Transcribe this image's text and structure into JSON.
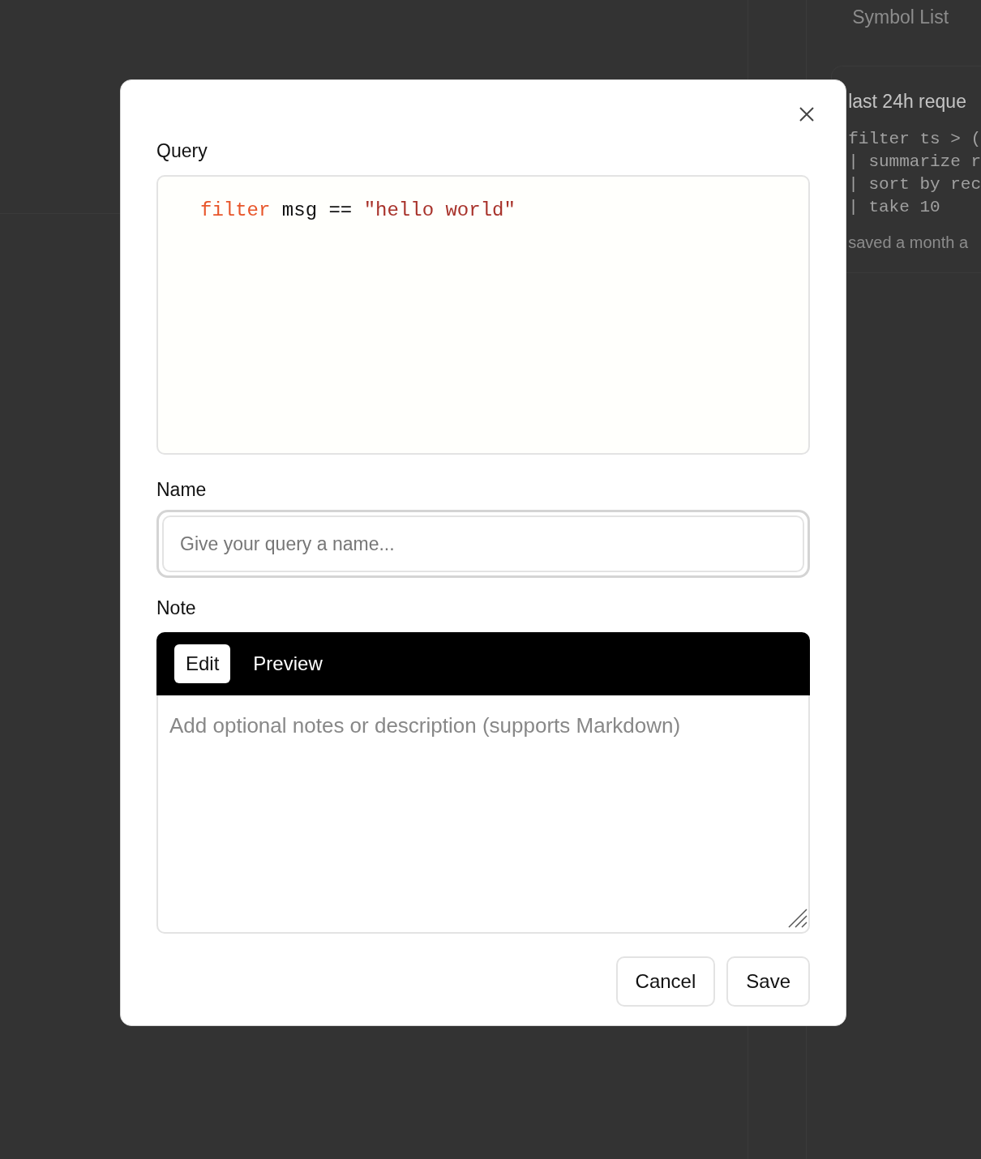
{
  "background": {
    "panel_title": "Symbol List",
    "card": {
      "title": "last 24h reque",
      "code_lines": [
        "filter ts > (",
        "| summarize r",
        "| sort by rec",
        "| take 10"
      ],
      "saved": "saved a month a"
    }
  },
  "dialog": {
    "query_label": "Query",
    "query_tokens": [
      {
        "kind": "keyword",
        "text": "filter"
      },
      {
        "kind": "plain",
        "text": " msg == "
      },
      {
        "kind": "string",
        "text": "\"hello world\""
      }
    ],
    "name_label": "Name",
    "name_field": {
      "placeholder": "Give your query a name...",
      "focused": true
    },
    "note_label": "Note",
    "note_tabs": [
      {
        "label": "Edit",
        "selected": true
      },
      {
        "label": "Preview",
        "selected": false
      }
    ],
    "note_field": {
      "placeholder": "Add optional notes or description (supports Markdown)"
    },
    "buttons": [
      "Cancel",
      "Save"
    ]
  }
}
